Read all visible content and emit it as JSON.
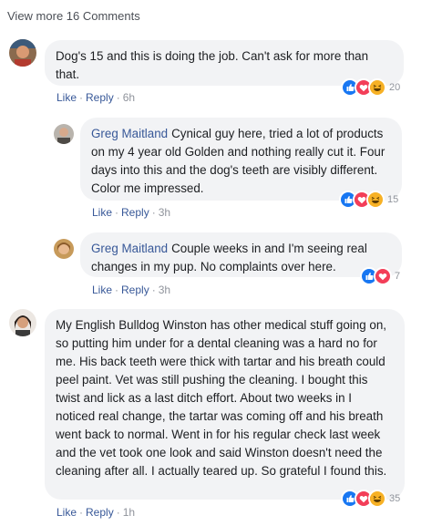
{
  "view_more": "View more 16 Comments",
  "colors": {
    "like": "#1877f2",
    "love": "#f33e58",
    "haha": "#f7b125",
    "link": "#385898"
  },
  "comments": [
    {
      "author": "",
      "text": "Dog's 15 and this is doing the job. Can't ask for more than that.",
      "like_label": "Like",
      "reply_label": "Reply",
      "time": "6h",
      "reactions": [
        "like",
        "love",
        "haha"
      ],
      "reaction_count": "20"
    },
    {
      "author": "Greg Maitland",
      "text": "Cynical guy here, tried a lot of products on my 4 year old Golden and nothing really cut it. Four days into this and the dog's teeth are visibly different. Color me impressed.",
      "like_label": "Like",
      "reply_label": "Reply",
      "time": "3h",
      "reactions": [
        "like",
        "love",
        "haha"
      ],
      "reaction_count": "15"
    },
    {
      "author": "Greg Maitland",
      "text": "Couple weeks in and I'm seeing real changes in my pup. No complaints over here.",
      "like_label": "Like",
      "reply_label": "Reply",
      "time": "3h",
      "reactions": [
        "like",
        "love"
      ],
      "reaction_count": "7"
    },
    {
      "author": "",
      "text": "My English Bulldog Winston has other medical stuff going on, so putting him under for a dental cleaning was a hard no for me. His back teeth were thick with tartar and his breath could peel paint. Vet was still pushing the cleaning. I bought this twist and lick as a last ditch effort. About two weeks in I noticed real change, the tartar was coming off and his breath went back to normal. Went in for his regular check last week and the vet took one look and said Winston doesn't need the cleaning after all. I actually teared up. So grateful I found this.",
      "like_label": "Like",
      "reply_label": "Reply",
      "time": "1h",
      "reactions": [
        "like",
        "love",
        "haha"
      ],
      "reaction_count": "35"
    }
  ]
}
